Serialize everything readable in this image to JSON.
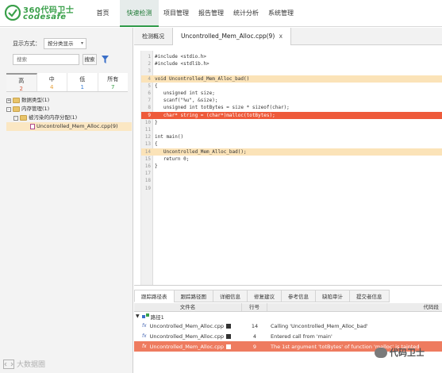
{
  "header": {
    "logo_cn": "360代码卫士",
    "logo_en": "codesafe",
    "nav": [
      "首页",
      "快速检测",
      "项目管理",
      "报告管理",
      "统计分析",
      "系统管理"
    ]
  },
  "sidebar": {
    "display_label": "显示方式：",
    "display_value": "按分类显示",
    "search_placeholder": "搜索",
    "search_button": "搜索",
    "severity": [
      {
        "name": "高",
        "count": "2"
      },
      {
        "name": "中",
        "count": "4"
      },
      {
        "name": "低",
        "count": "1"
      },
      {
        "name": "所有",
        "count": "7"
      }
    ],
    "tree": [
      {
        "toggle": "+",
        "label": "数据类型(1)"
      },
      {
        "toggle": "-",
        "label": "内存管理(1)"
      },
      {
        "toggle": "-",
        "label": "被污染的内存分配(1)"
      },
      {
        "toggle": "",
        "label": "Uncontrolled_Mem_Alloc.cpp(9)"
      }
    ]
  },
  "editor": {
    "tabs": [
      "检测概况",
      "Uncontrolled_Mem_Alloc.cpp(9)"
    ],
    "tab_close": "x",
    "lines": [
      {
        "n": "1",
        "t": "#include <stdio.h>"
      },
      {
        "n": "2",
        "t": "#include <stdlib.h>"
      },
      {
        "n": "3",
        "t": ""
      },
      {
        "n": "4",
        "t": "void Uncontrolled_Mem_Alloc_bad()"
      },
      {
        "n": "5",
        "t": "{"
      },
      {
        "n": "6",
        "t": "   unsigned int size;"
      },
      {
        "n": "7",
        "t": "   scanf(\"%u\", &size);"
      },
      {
        "n": "8",
        "t": "   unsigned int totBytes = size * sizeof(char);"
      },
      {
        "n": "9",
        "t": "   char* string = (char*)malloc(totBytes);"
      },
      {
        "n": "10",
        "t": "}"
      },
      {
        "n": "11",
        "t": ""
      },
      {
        "n": "12",
        "t": "int main()"
      },
      {
        "n": "13",
        "t": "{"
      },
      {
        "n": "14",
        "t": "   Uncontrolled_Mem_Alloc_bad();"
      },
      {
        "n": "15",
        "t": "   return 0;"
      },
      {
        "n": "16",
        "t": "}"
      },
      {
        "n": "17",
        "t": ""
      },
      {
        "n": "18",
        "t": ""
      },
      {
        "n": "19",
        "t": ""
      }
    ],
    "highlight_lines": [
      "4",
      "14"
    ],
    "error_line": "9"
  },
  "bottom": {
    "tabs": [
      "跟踪路径表",
      "跟踪路径图",
      "详细信息",
      "修复建议",
      "参考信息",
      "缺陷审计",
      "提交者信息"
    ],
    "columns": [
      "文件名",
      "行号",
      "代码段"
    ],
    "path_label": "路径1",
    "rows": [
      {
        "file": "Uncontrolled_Mem_Alloc.cpp",
        "line": "14",
        "code": "Calling 'Uncontrolled_Mem_Alloc_bad'"
      },
      {
        "file": "Uncontrolled_Mem_Alloc.cpp",
        "line": "4",
        "code": "Entered call from 'main'"
      },
      {
        "file": "Uncontrolled_Mem_Alloc.cpp",
        "line": "9",
        "code": "The 1st argument 'totBytes' of function 'malloc' is tainted"
      }
    ]
  },
  "watermarks": {
    "left": "大数据圈",
    "right": "代码卫士"
  },
  "colors": {
    "brand_green": "#3aa04a",
    "nav_active_border": "#2e9a48",
    "highlight": "#fbe3b8",
    "error": "#ee5a3a",
    "selected_row": "#ee7b5f",
    "sev_high": "#d6583a",
    "sev_mid": "#e6a13a",
    "sev_low": "#3a7fd6",
    "sev_all": "#3aa04a"
  }
}
